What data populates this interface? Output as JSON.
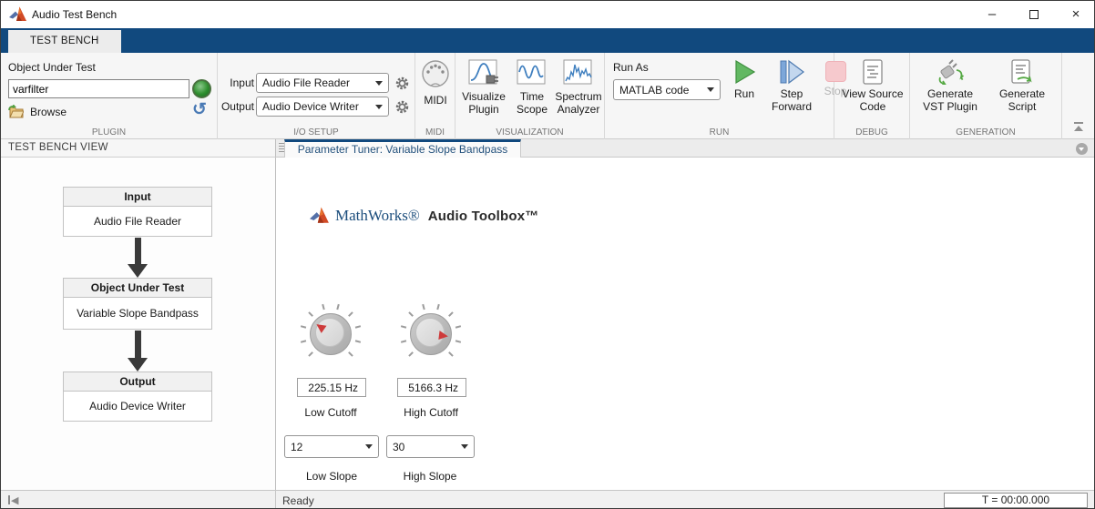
{
  "window": {
    "title": "Audio Test Bench",
    "minimize_glyph": "–",
    "close_glyph": "×"
  },
  "ribbon": {
    "tab_label": "TEST BENCH",
    "plugin": {
      "caption": "PLUGIN",
      "object_under_test_label": "Object Under Test",
      "object_under_test_value": "varfilter",
      "browse_label": "Browse"
    },
    "io_setup": {
      "caption": "I/O SETUP",
      "input_label": "Input",
      "input_value": "Audio File Reader",
      "output_label": "Output",
      "output_value": "Audio Device Writer"
    },
    "midi": {
      "caption": "MIDI",
      "midi_button_label": "MIDI"
    },
    "visualization": {
      "caption": "VISUALIZATION",
      "visualize_plugin_label": "Visualize Plugin",
      "time_scope_label": "Time Scope",
      "spectrum_analyzer_label": "Spectrum Analyzer"
    },
    "run": {
      "caption": "RUN",
      "run_as_label": "Run As",
      "run_as_value": "MATLAB code",
      "run_label": "Run",
      "step_forward_label": "Step Forward",
      "stop_label": "Stop"
    },
    "debug": {
      "caption": "DEBUG",
      "view_source_code_label": "View Source Code"
    },
    "generation": {
      "caption": "GENERATION",
      "generate_vst_label": "Generate VST Plugin",
      "generate_script_label": "Generate Script"
    }
  },
  "left_panel": {
    "header": "TEST BENCH VIEW",
    "flow": [
      {
        "title": "Input",
        "value": "Audio File Reader"
      },
      {
        "title": "Object Under Test",
        "value": "Variable Slope Bandpass"
      },
      {
        "title": "Output",
        "value": "Audio Device Writer"
      }
    ]
  },
  "main_panel": {
    "tab_label": "Parameter Tuner: Variable Slope Bandpass",
    "brand": {
      "mathworks": "MathWorks®",
      "toolbox": "Audio Toolbox™"
    },
    "knobs": {
      "low_cutoff": {
        "value": "225.15 Hz",
        "label": "Low Cutoff"
      },
      "high_cutoff": {
        "value": "5166.3 Hz",
        "label": "High Cutoff"
      }
    },
    "selects": {
      "low_slope": {
        "value": "12",
        "label": "Low Slope"
      },
      "high_slope": {
        "value": "30",
        "label": "High Slope"
      }
    }
  },
  "status_bar": {
    "message": "Ready",
    "time": "T = 00:00.000"
  },
  "icons": {
    "undo_glyph": "↺",
    "panel_collapse_glyph": "◀"
  },
  "colors": {
    "toolstrip_navy": "#11497E",
    "active_tab_accent": "#11497E",
    "run_green": "#52B152",
    "stop_pink": "#F6C9CD",
    "knob_pointer_red": "#CE3B3B",
    "mathworks_blue": "#1B4D7C",
    "matlab_logo_red": "#D14A26"
  }
}
